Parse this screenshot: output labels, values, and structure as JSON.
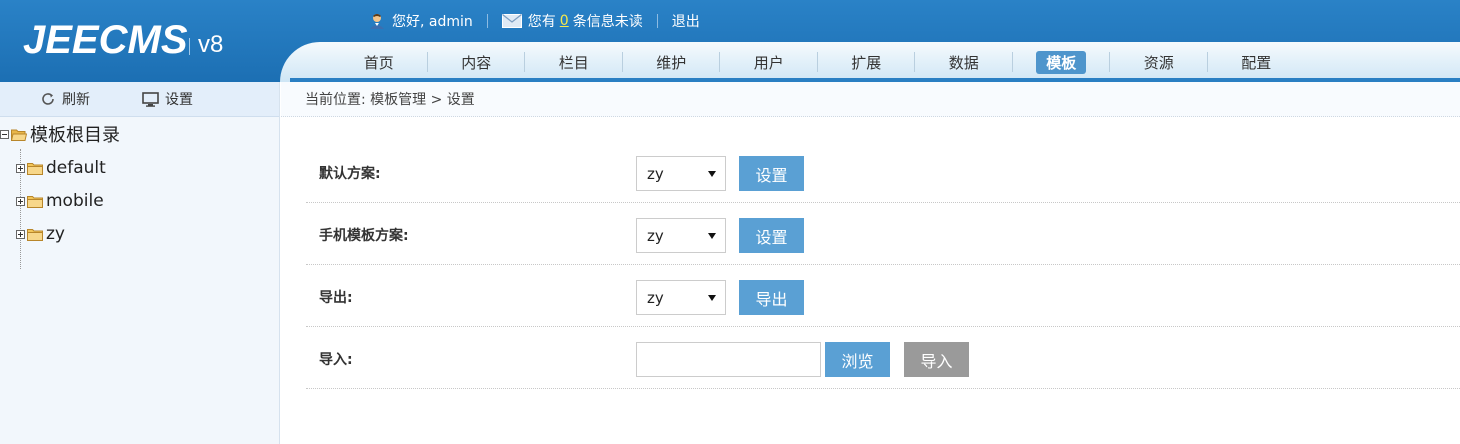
{
  "app": {
    "logo": "JEECMS",
    "version": "v8"
  },
  "topbar": {
    "greeting": "您好, admin",
    "messages_prefix": "您有",
    "messages_count": "0",
    "messages_suffix": "条信息未读",
    "logout": "退出"
  },
  "nav": {
    "items": [
      "首页",
      "内容",
      "栏目",
      "维护",
      "用户",
      "扩展",
      "数据",
      "模板",
      "资源",
      "配置"
    ],
    "active": "模板"
  },
  "sidebar": {
    "refresh": "刷新",
    "settings": "设置",
    "tree": {
      "root": "模板根目录",
      "children": [
        "default",
        "mobile",
        "zy"
      ]
    }
  },
  "breadcrumb": "当前位置: 模板管理 > 设置",
  "form": {
    "default_scheme": {
      "label": "默认方案:",
      "value": "zy",
      "button": "设置"
    },
    "mobile_scheme": {
      "label": "手机模板方案:",
      "value": "zy",
      "button": "设置"
    },
    "export": {
      "label": "导出:",
      "value": "zy",
      "button": "导出"
    },
    "import": {
      "label": "导入:",
      "value": "",
      "browse": "浏览",
      "button": "导入"
    }
  },
  "colors": {
    "header": "#1c6fb3",
    "accent_button": "#5aa0d4",
    "disabled_button": "#9a9a9a",
    "unread_count": "#f7ea4a"
  }
}
